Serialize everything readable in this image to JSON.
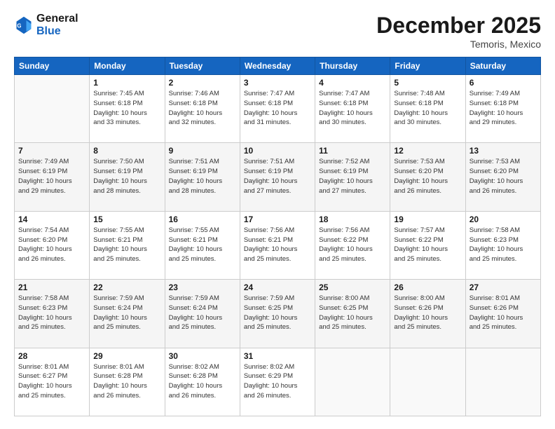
{
  "header": {
    "logo_line1": "General",
    "logo_line2": "Blue",
    "month_year": "December 2025",
    "location": "Temoris, Mexico"
  },
  "weekdays": [
    "Sunday",
    "Monday",
    "Tuesday",
    "Wednesday",
    "Thursday",
    "Friday",
    "Saturday"
  ],
  "weeks": [
    [
      {
        "day": "",
        "text": ""
      },
      {
        "day": "1",
        "text": "Sunrise: 7:45 AM\nSunset: 6:18 PM\nDaylight: 10 hours\nand 33 minutes."
      },
      {
        "day": "2",
        "text": "Sunrise: 7:46 AM\nSunset: 6:18 PM\nDaylight: 10 hours\nand 32 minutes."
      },
      {
        "day": "3",
        "text": "Sunrise: 7:47 AM\nSunset: 6:18 PM\nDaylight: 10 hours\nand 31 minutes."
      },
      {
        "day": "4",
        "text": "Sunrise: 7:47 AM\nSunset: 6:18 PM\nDaylight: 10 hours\nand 30 minutes."
      },
      {
        "day": "5",
        "text": "Sunrise: 7:48 AM\nSunset: 6:18 PM\nDaylight: 10 hours\nand 30 minutes."
      },
      {
        "day": "6",
        "text": "Sunrise: 7:49 AM\nSunset: 6:18 PM\nDaylight: 10 hours\nand 29 minutes."
      }
    ],
    [
      {
        "day": "7",
        "text": "Sunrise: 7:49 AM\nSunset: 6:19 PM\nDaylight: 10 hours\nand 29 minutes."
      },
      {
        "day": "8",
        "text": "Sunrise: 7:50 AM\nSunset: 6:19 PM\nDaylight: 10 hours\nand 28 minutes."
      },
      {
        "day": "9",
        "text": "Sunrise: 7:51 AM\nSunset: 6:19 PM\nDaylight: 10 hours\nand 28 minutes."
      },
      {
        "day": "10",
        "text": "Sunrise: 7:51 AM\nSunset: 6:19 PM\nDaylight: 10 hours\nand 27 minutes."
      },
      {
        "day": "11",
        "text": "Sunrise: 7:52 AM\nSunset: 6:19 PM\nDaylight: 10 hours\nand 27 minutes."
      },
      {
        "day": "12",
        "text": "Sunrise: 7:53 AM\nSunset: 6:20 PM\nDaylight: 10 hours\nand 26 minutes."
      },
      {
        "day": "13",
        "text": "Sunrise: 7:53 AM\nSunset: 6:20 PM\nDaylight: 10 hours\nand 26 minutes."
      }
    ],
    [
      {
        "day": "14",
        "text": "Sunrise: 7:54 AM\nSunset: 6:20 PM\nDaylight: 10 hours\nand 26 minutes."
      },
      {
        "day": "15",
        "text": "Sunrise: 7:55 AM\nSunset: 6:21 PM\nDaylight: 10 hours\nand 25 minutes."
      },
      {
        "day": "16",
        "text": "Sunrise: 7:55 AM\nSunset: 6:21 PM\nDaylight: 10 hours\nand 25 minutes."
      },
      {
        "day": "17",
        "text": "Sunrise: 7:56 AM\nSunset: 6:21 PM\nDaylight: 10 hours\nand 25 minutes."
      },
      {
        "day": "18",
        "text": "Sunrise: 7:56 AM\nSunset: 6:22 PM\nDaylight: 10 hours\nand 25 minutes."
      },
      {
        "day": "19",
        "text": "Sunrise: 7:57 AM\nSunset: 6:22 PM\nDaylight: 10 hours\nand 25 minutes."
      },
      {
        "day": "20",
        "text": "Sunrise: 7:58 AM\nSunset: 6:23 PM\nDaylight: 10 hours\nand 25 minutes."
      }
    ],
    [
      {
        "day": "21",
        "text": "Sunrise: 7:58 AM\nSunset: 6:23 PM\nDaylight: 10 hours\nand 25 minutes."
      },
      {
        "day": "22",
        "text": "Sunrise: 7:59 AM\nSunset: 6:24 PM\nDaylight: 10 hours\nand 25 minutes."
      },
      {
        "day": "23",
        "text": "Sunrise: 7:59 AM\nSunset: 6:24 PM\nDaylight: 10 hours\nand 25 minutes."
      },
      {
        "day": "24",
        "text": "Sunrise: 7:59 AM\nSunset: 6:25 PM\nDaylight: 10 hours\nand 25 minutes."
      },
      {
        "day": "25",
        "text": "Sunrise: 8:00 AM\nSunset: 6:25 PM\nDaylight: 10 hours\nand 25 minutes."
      },
      {
        "day": "26",
        "text": "Sunrise: 8:00 AM\nSunset: 6:26 PM\nDaylight: 10 hours\nand 25 minutes."
      },
      {
        "day": "27",
        "text": "Sunrise: 8:01 AM\nSunset: 6:26 PM\nDaylight: 10 hours\nand 25 minutes."
      }
    ],
    [
      {
        "day": "28",
        "text": "Sunrise: 8:01 AM\nSunset: 6:27 PM\nDaylight: 10 hours\nand 25 minutes."
      },
      {
        "day": "29",
        "text": "Sunrise: 8:01 AM\nSunset: 6:28 PM\nDaylight: 10 hours\nand 26 minutes."
      },
      {
        "day": "30",
        "text": "Sunrise: 8:02 AM\nSunset: 6:28 PM\nDaylight: 10 hours\nand 26 minutes."
      },
      {
        "day": "31",
        "text": "Sunrise: 8:02 AM\nSunset: 6:29 PM\nDaylight: 10 hours\nand 26 minutes."
      },
      {
        "day": "",
        "text": ""
      },
      {
        "day": "",
        "text": ""
      },
      {
        "day": "",
        "text": ""
      }
    ]
  ]
}
